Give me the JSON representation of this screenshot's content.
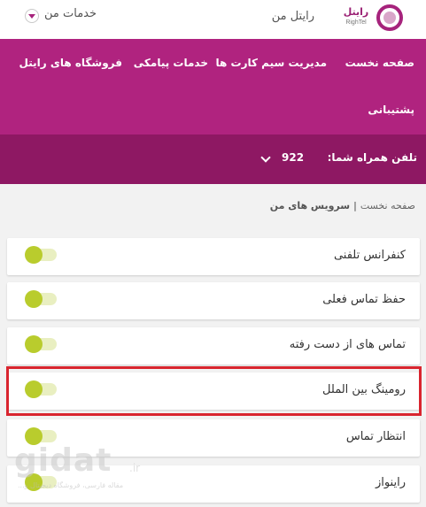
{
  "header": {
    "logo_text": "رایتل",
    "logo_sub": "RighTel",
    "my_rightel": "رایتل من",
    "my_services": "خدمات من"
  },
  "nav": {
    "items": [
      "صفحه نخست",
      "مدیریت سیم کارت ها",
      "خدمات پیامکی",
      "فروشگاه های رایتل",
      "پشتیبانی"
    ]
  },
  "phone": {
    "label": "تلفن همراه شما:",
    "number": "922"
  },
  "breadcrumb": {
    "home": "صفحه نخست",
    "separator": "|",
    "current": "سرویس های من"
  },
  "services": [
    {
      "label": "کنفرانس تلفنی",
      "enabled": true
    },
    {
      "label": "حفظ تماس فعلی",
      "enabled": true
    },
    {
      "label": "تماس های از دست رفته",
      "enabled": true
    },
    {
      "label": "رومینگ بین الملل",
      "enabled": true,
      "highlighted": true
    },
    {
      "label": "انتظار تماس",
      "enabled": true
    },
    {
      "label": "راینواز",
      "enabled": true
    }
  ],
  "watermark": {
    "main": "gidat",
    "tld": ".ir",
    "sub": "مقاله فارسی، فروشگاه دیجیتال و..."
  },
  "colors": {
    "brand": "#b0237f",
    "brand_dark": "#8e1863",
    "toggle": "#b9cc2d",
    "highlight": "#d9252f"
  }
}
